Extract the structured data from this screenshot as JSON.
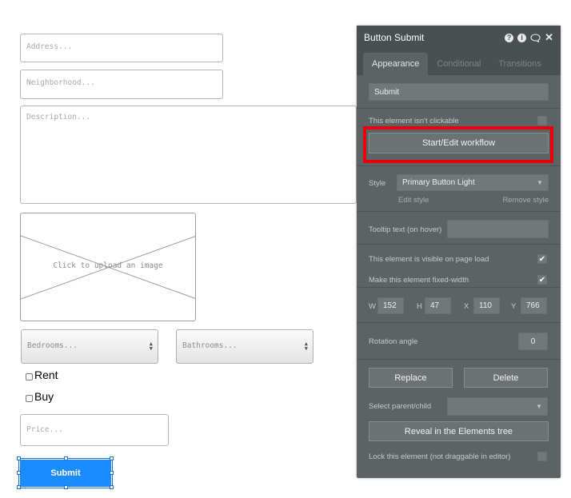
{
  "canvas": {
    "address_placeholder": "Address...",
    "neighborhood_placeholder": "Neighborhood...",
    "description_placeholder": "Description...",
    "image_uploader_text": "Click to upload an image",
    "bedrooms_placeholder": "Bedrooms...",
    "bathrooms_placeholder": "Bathrooms...",
    "rent_label": "Rent",
    "buy_label": "Buy",
    "price_placeholder": "Price...",
    "submit_label": "Submit"
  },
  "panel": {
    "title": "Button Submit",
    "tabs": [
      {
        "label": "Appearance",
        "active": true
      },
      {
        "label": "Conditional",
        "active": false
      },
      {
        "label": "Transitions",
        "active": false
      }
    ],
    "text_value": "Submit",
    "not_clickable_label": "This element isn't clickable",
    "workflow_button": "Start/Edit workflow",
    "style_label": "Style",
    "style_value": "Primary Button Light",
    "edit_style": "Edit style",
    "remove_style": "Remove style",
    "tooltip_label": "Tooltip text (on hover)",
    "visible_label": "This element is visible on page load",
    "fixed_width_label": "Make this element fixed-width",
    "dims": {
      "w_label": "W",
      "w": "152",
      "h_label": "H",
      "h": "47",
      "x_label": "X",
      "x": "110",
      "y_label": "Y",
      "y": "766"
    },
    "rotation_label": "Rotation angle",
    "rotation_value": "0",
    "replace_button": "Replace",
    "delete_button": "Delete",
    "parent_label": "Select parent/child",
    "reveal_button": "Reveal in the Elements tree",
    "lock_label": "Lock this element (not draggable in editor)"
  },
  "colors": {
    "panel_bg": "#5d6364",
    "panel_header": "#4a4f50",
    "submit_blue": "#1a8cff",
    "highlight_red": "#e8000b"
  }
}
